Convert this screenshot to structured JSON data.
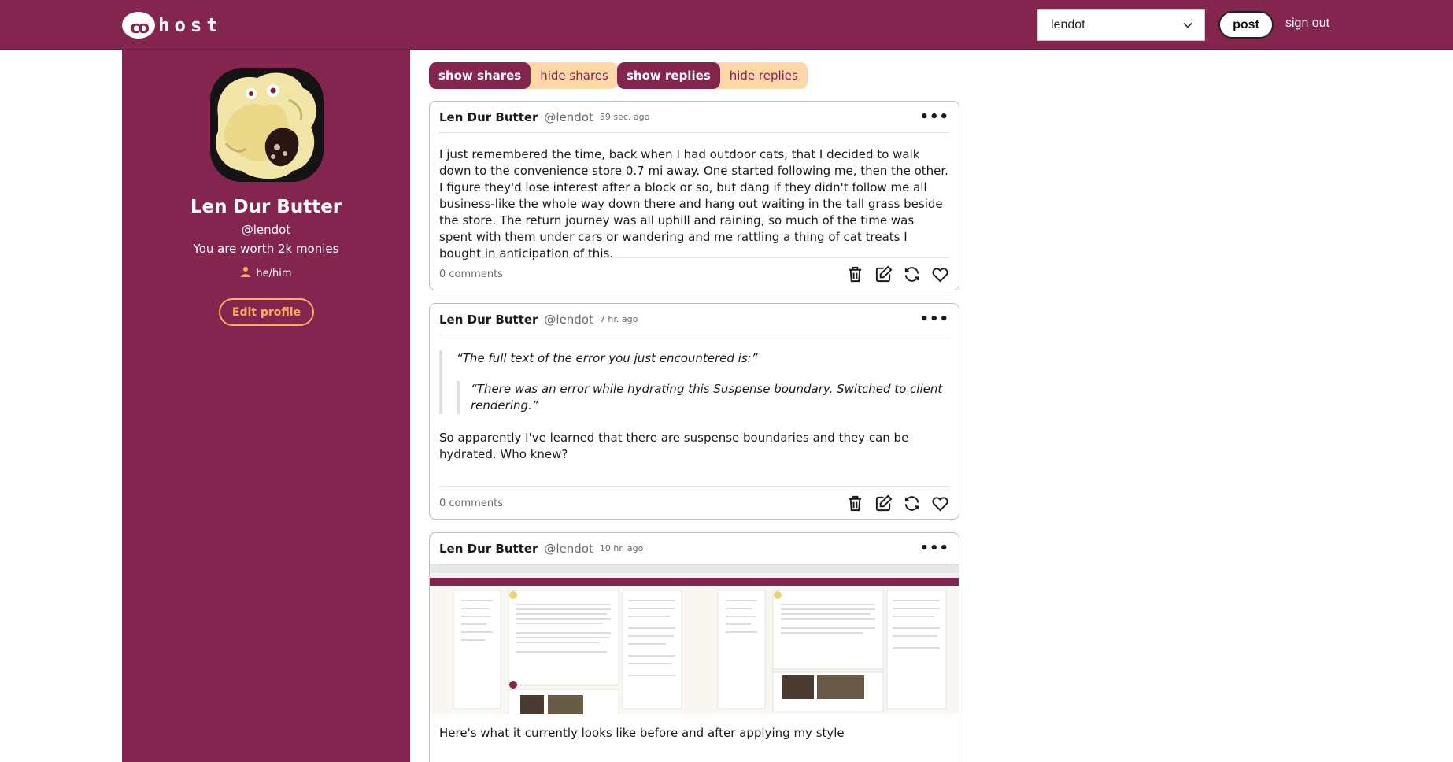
{
  "header": {
    "logo_text": "host",
    "logo_egg": "co",
    "page_selector_value": "lendot",
    "post_label": "post",
    "signout_label": "sign out"
  },
  "profile": {
    "display_name": "Len Dur Butter",
    "handle": "@lendot",
    "bio": "You are worth 2k monies",
    "pronouns": "he/him",
    "edit_label": "Edit profile"
  },
  "filters": {
    "shares_on": "show shares",
    "shares_off": "hide shares",
    "replies_on": "show replies",
    "replies_off": "hide replies"
  },
  "posts": [
    {
      "author": "Len Dur Butter",
      "handle": "@lendot",
      "time": "59 sec. ago",
      "body": "I just remembered the time, back when I had outdoor cats, that I decided to walk down to the convenience store 0.7 mi away. One started following me, then the other. I figure they'd lose interest after a block or so, but dang if they didn't follow me all business-like the whole way down there and hang out waiting in the tall grass beside the store. The return journey was all uphill and raining, so much of the time was spent with them under cars or wandering and me rattling a thing of cat treats I bought in anticipation of this.",
      "comments": "0 comments"
    },
    {
      "author": "Len Dur Butter",
      "handle": "@lendot",
      "time": "7 hr. ago",
      "quote": "“The full text of the error you just encountered is:”",
      "inner_quote": "“There was an error while hydrating this Suspense boundary. Switched to client rendering.”",
      "body": "So apparently I've learned that there are suspense boundaries and they can be hydrated. Who knew?",
      "comments": "0 comments"
    },
    {
      "author": "Len Dur Butter",
      "handle": "@lendot",
      "time": "10 hr. ago",
      "caption": "Here's what it currently looks like before and after applying my style"
    }
  ],
  "colors": {
    "brand": "#83254f",
    "accent": "#ffab5c",
    "toggle_bg": "#ffd8a8"
  },
  "icons": [
    "chevron-down-icon",
    "person-icon",
    "more-icon",
    "trash-icon",
    "edit-icon",
    "share-icon",
    "heart-icon"
  ]
}
